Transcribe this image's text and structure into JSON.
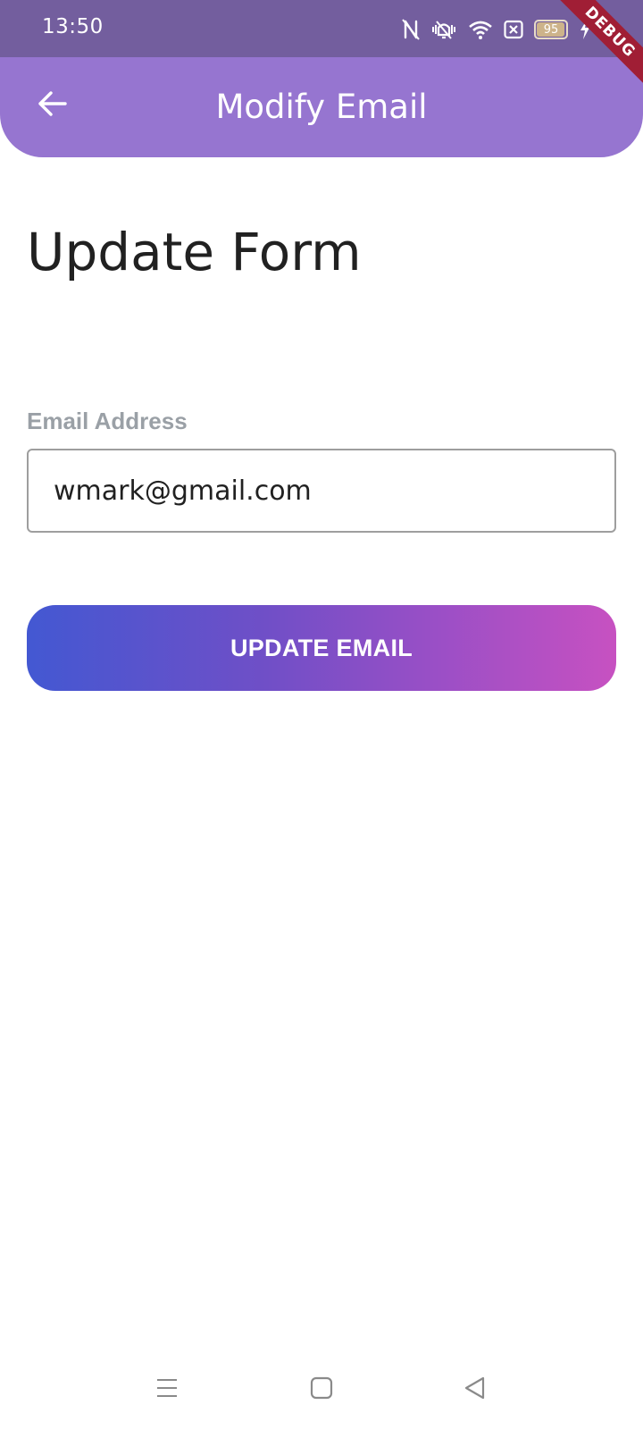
{
  "status_bar": {
    "time": "13:50",
    "battery_level": "95",
    "debug_label": "DEBUG",
    "icons": [
      "nfc-icon",
      "vibrate-icon",
      "wifi-icon",
      "sim-off-icon",
      "battery-icon",
      "charging-icon"
    ]
  },
  "app_bar": {
    "title": "Modify Email",
    "back_icon": "arrow-back-icon"
  },
  "form": {
    "title": "Update Form",
    "email_label": "Email Address",
    "email_value": "wmark@gmail.com",
    "submit_label": "UPDATE EMAIL"
  },
  "nav_bar": {
    "icons": [
      "menu-icon",
      "home-icon",
      "back-triangle-icon"
    ]
  },
  "colors": {
    "status_bar": "#735e9e",
    "app_bar": "#9675d0",
    "button_gradient_start": "#4358d2",
    "button_gradient_end": "#c751c1",
    "debug_ribbon": "#a01e35"
  }
}
